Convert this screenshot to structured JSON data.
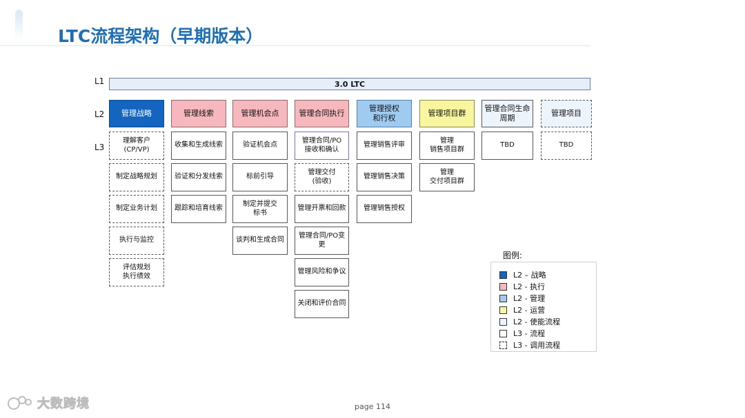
{
  "title": "LTC流程架构（早期版本）",
  "levels": {
    "l1": "L1",
    "l2": "L2",
    "l3": "L3"
  },
  "l1": {
    "label": "3.0 LTC"
  },
  "columns": [
    {
      "l2": "管理战略",
      "l2_type": "strategy",
      "l3": [
        {
          "text": "理解客户\n(CP/VP)",
          "style": "dashed"
        },
        {
          "text": "制定战略规划",
          "style": "dashed"
        },
        {
          "text": "制定业务计划",
          "style": "dashed"
        },
        {
          "text": "执行与监控",
          "style": "dashed"
        },
        {
          "text": "评估规划\n执行绩效",
          "style": "dashed"
        }
      ]
    },
    {
      "l2": "管理线索",
      "l2_type": "exec",
      "l3": [
        {
          "text": "收集和生成线索",
          "style": "solid"
        },
        {
          "text": "验证和分发线索",
          "style": "solid"
        },
        {
          "text": "跟踪和培育线索",
          "style": "solid"
        }
      ]
    },
    {
      "l2": "管理机会点",
      "l2_type": "exec",
      "l3": [
        {
          "text": "验证机会点",
          "style": "solid"
        },
        {
          "text": "标前引导",
          "style": "solid"
        },
        {
          "text": "制定并提交\n标书",
          "style": "solid"
        },
        {
          "text": "谈判和生成合同",
          "style": "solid"
        }
      ]
    },
    {
      "l2": "管理合同执行",
      "l2_type": "exec",
      "l3": [
        {
          "text": "管理合同/PO\n接收和确认",
          "style": "framed"
        },
        {
          "text": "管理交付\n(验收)",
          "style": "dashed"
        },
        {
          "text": "管理开票和回款",
          "style": "solid"
        },
        {
          "text": "管理合同/PO变\n更",
          "style": "solid"
        },
        {
          "text": "管理风险和争议",
          "style": "solid"
        },
        {
          "text": "关闭和评价合同",
          "style": "solid"
        }
      ]
    },
    {
      "l2": "管理授权\n和行权",
      "l2_type": "manage",
      "l3": [
        {
          "text": "管理销售评审",
          "style": "solid"
        },
        {
          "text": "管理销售决策",
          "style": "solid"
        },
        {
          "text": "管理销售授权",
          "style": "solid"
        }
      ]
    },
    {
      "l2": "管理项目群",
      "l2_type": "ops",
      "l3": [
        {
          "text": "管理\n销售项目群",
          "style": "solid"
        },
        {
          "text": "管理\n交付项目群",
          "style": "solid"
        }
      ]
    },
    {
      "l2": "管理合同生命\n周期",
      "l2_type": "enable",
      "l3": [
        {
          "text": "TBD",
          "style": "solid"
        }
      ]
    },
    {
      "l2": "管理项目",
      "l2_type": "enable-dashed",
      "l3": [
        {
          "text": "TBD",
          "style": "dashed"
        }
      ]
    }
  ],
  "legend": {
    "title": "图例:",
    "items": [
      {
        "label": "L2 – 战略",
        "color": "#1365c0",
        "style": "solid"
      },
      {
        "label": "L2 - 执行",
        "color": "#f6b8bc",
        "style": "solid"
      },
      {
        "label": "L2 - 管理",
        "color": "#9fcbf1",
        "style": "solid"
      },
      {
        "label": "L2 - 运营",
        "color": "#f8f7a0",
        "style": "solid"
      },
      {
        "label": "L2 - 使能流程",
        "color": "#eef4fc",
        "style": "solid"
      },
      {
        "label": "L3 - 流程",
        "color": "#ffffff",
        "style": "solid"
      },
      {
        "label": "L3 - 调用流程",
        "color": "#ffffff",
        "style": "dashed"
      }
    ]
  },
  "footer": {
    "page": "page 114"
  },
  "watermark": {
    "text": "大数跨境"
  }
}
